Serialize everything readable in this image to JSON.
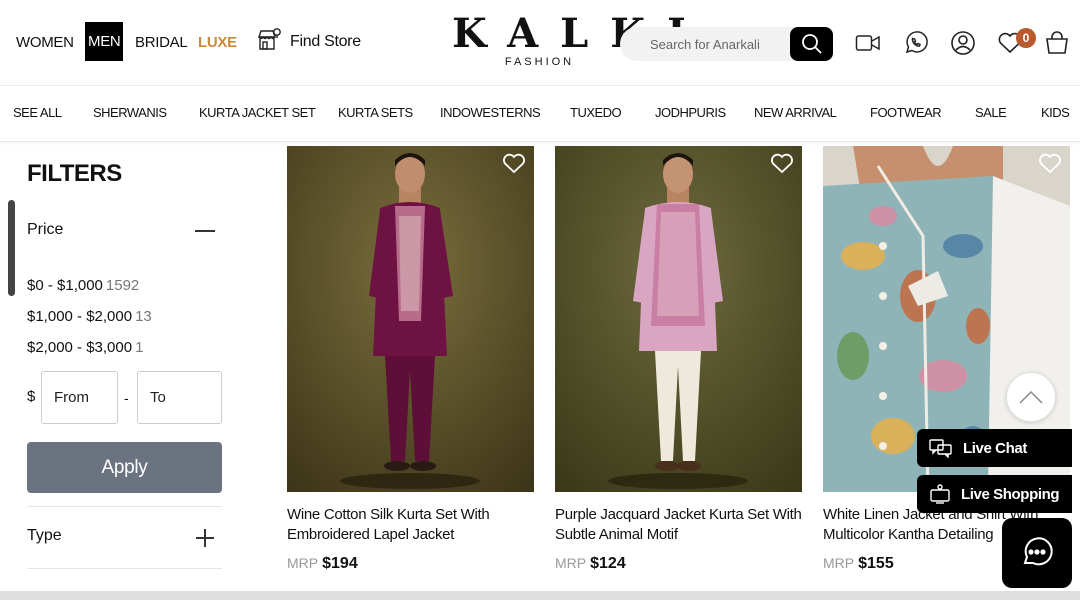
{
  "header": {
    "gender_tabs": [
      "WOMEN",
      "MEN",
      "BRIDAL",
      "LUXE"
    ],
    "find_store": "Find Store",
    "logo_main": "KALKI",
    "logo_sub": "FASHION",
    "search_placeholder": "Search for Anarkali",
    "cart_count": "0",
    "icons": [
      "store-icon",
      "search-icon",
      "video-call-icon",
      "whatsapp-icon",
      "account-icon",
      "wishlist-icon",
      "cart-icon"
    ],
    "colors": {
      "luxe": "#c98a3a",
      "badge": "#b85a2e"
    }
  },
  "categories": [
    "SEE ALL",
    "SHERWANIS",
    "KURTA JACKET SET",
    "KURTA SETS",
    "INDOWESTERNS",
    "TUXEDO",
    "JODHPURIS",
    "NEW ARRIVAL",
    "FOOTWEAR",
    "SALE",
    "KIDS"
  ],
  "filters": {
    "title": "FILTERS",
    "price_label": "Price",
    "ranges": [
      {
        "label": "$0 - $1,000",
        "count": "1592"
      },
      {
        "label": "$1,000 - $2,000",
        "count": "13"
      },
      {
        "label": "$2,000 - $3,000",
        "count": "1"
      }
    ],
    "currency": "$",
    "from_placeholder": "From",
    "to_placeholder": "To",
    "dash": "-",
    "apply": "Apply",
    "type_label": "Type"
  },
  "products": [
    {
      "name": "Wine Cotton Silk Kurta Set With Embroidered Lapel Jacket",
      "mrp": "MRP",
      "price": "$194"
    },
    {
      "name": "Purple Jacquard Jacket Kurta Set With Subtle Animal Motif",
      "mrp": "MRP",
      "price": "$124"
    },
    {
      "name": "White Linen Jacket and Shirt With Multicolor Kantha Detailing",
      "mrp": "MRP",
      "price": "$155"
    }
  ],
  "floating": {
    "live_chat": "Live Chat",
    "live_shopping": "Live Shopping"
  }
}
